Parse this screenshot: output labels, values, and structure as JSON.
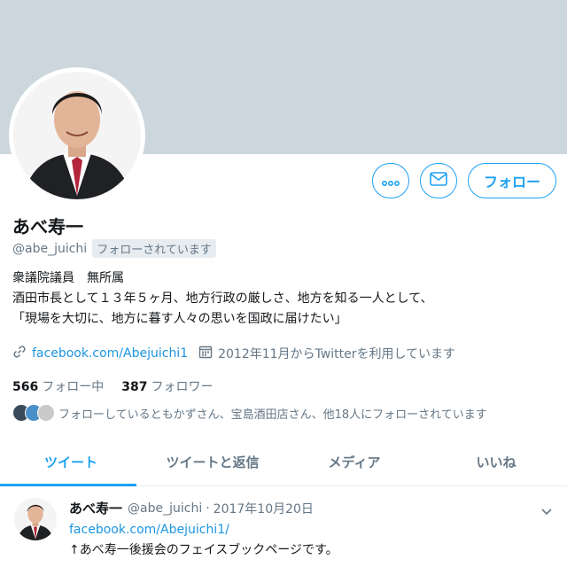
{
  "profile": {
    "name": "あべ寿一",
    "handle": "@abe_juichi",
    "follows_you": "フォローされています",
    "bio_line1": "衆議院議員　無所属",
    "bio_line2": "酒田市長として１３年５ヶ月、地方行政の厳しさ、地方を知る一人として、",
    "bio_line3": "「現場を大切に、地方に暮す人々の思いを国政に届けたい」",
    "website": "facebook.com/Abejuichi1",
    "joined": "2012年11月からTwitterを利用しています"
  },
  "actions": {
    "follow_label": "フォロー",
    "more_icon": "more-icon",
    "dm_icon": "mail-icon"
  },
  "counts": {
    "following_num": "566",
    "following_label": "フォロー中",
    "followers_num": "387",
    "followers_label": "フォロワー"
  },
  "followers_you_know": {
    "text": "フォローしているともかずさん、宝島酒田店さん、他18人にフォローされています"
  },
  "tabs": [
    {
      "label": "ツイート",
      "active": true
    },
    {
      "label": "ツイートと返信",
      "active": false
    },
    {
      "label": "メディア",
      "active": false
    },
    {
      "label": "いいね",
      "active": false
    }
  ],
  "tweet": {
    "name": "あべ寿一",
    "handle": "@abe_juichi",
    "separator": "·",
    "date": "2017年10月20日",
    "link": "facebook.com/Abejuichi1/",
    "text": "↑あべ寿一後援会のフェイスブックページです。"
  },
  "colors": {
    "accent": "#1da1f2",
    "link": "#1b95e0",
    "banner": "#ccd6dd",
    "muted": "#657786"
  }
}
